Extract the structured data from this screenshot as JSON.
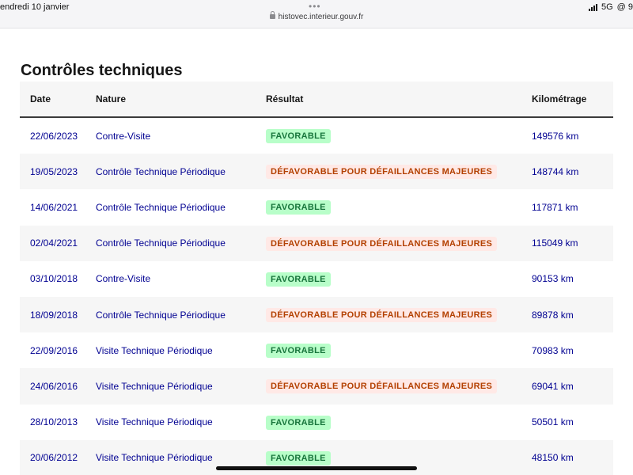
{
  "statusbar": {
    "datetime": "endredi 10 janvier",
    "network": "5G",
    "extra": "@ 9",
    "url": "histovec.interieur.gouv.fr"
  },
  "page": {
    "title": "Contrôles techniques"
  },
  "table": {
    "headers": {
      "date": "Date",
      "nature": "Nature",
      "result": "Résultat",
      "km": "Kilométrage"
    },
    "rows": [
      {
        "date": "22/06/2023",
        "nature": "Contre-Visite",
        "result": "FAVORABLE",
        "km": "149576 km"
      },
      {
        "date": "19/05/2023",
        "nature": "Contrôle Technique Périodique",
        "result": "DÉFAVORABLE POUR DÉFAILLANCES MAJEURES",
        "km": "148744 km"
      },
      {
        "date": "14/06/2021",
        "nature": "Contrôle Technique Périodique",
        "result": "FAVORABLE",
        "km": "117871 km"
      },
      {
        "date": "02/04/2021",
        "nature": "Contrôle Technique Périodique",
        "result": "DÉFAVORABLE POUR DÉFAILLANCES MAJEURES",
        "km": "115049 km"
      },
      {
        "date": "03/10/2018",
        "nature": "Contre-Visite",
        "result": "FAVORABLE",
        "km": "90153 km"
      },
      {
        "date": "18/09/2018",
        "nature": "Contrôle Technique Périodique",
        "result": "DÉFAVORABLE POUR DÉFAILLANCES MAJEURES",
        "km": "89878 km"
      },
      {
        "date": "22/09/2016",
        "nature": "Visite Technique Périodique",
        "result": "FAVORABLE",
        "km": "70983 km"
      },
      {
        "date": "24/06/2016",
        "nature": "Visite Technique Périodique",
        "result": "DÉFAVORABLE POUR DÉFAILLANCES MAJEURES",
        "km": "69041 km"
      },
      {
        "date": "28/10/2013",
        "nature": "Visite Technique Périodique",
        "result": "FAVORABLE",
        "km": "50501 km"
      },
      {
        "date": "20/06/2012",
        "nature": "Visite Technique Périodique",
        "result": "FAVORABLE",
        "km": "48150 km"
      }
    ]
  },
  "colors": {
    "link": "#000091",
    "favorable_bg": "#b8fec9",
    "favorable_text": "#18753c",
    "defavorable_bg": "#ffe9e6",
    "defavorable_text": "#b34000"
  }
}
